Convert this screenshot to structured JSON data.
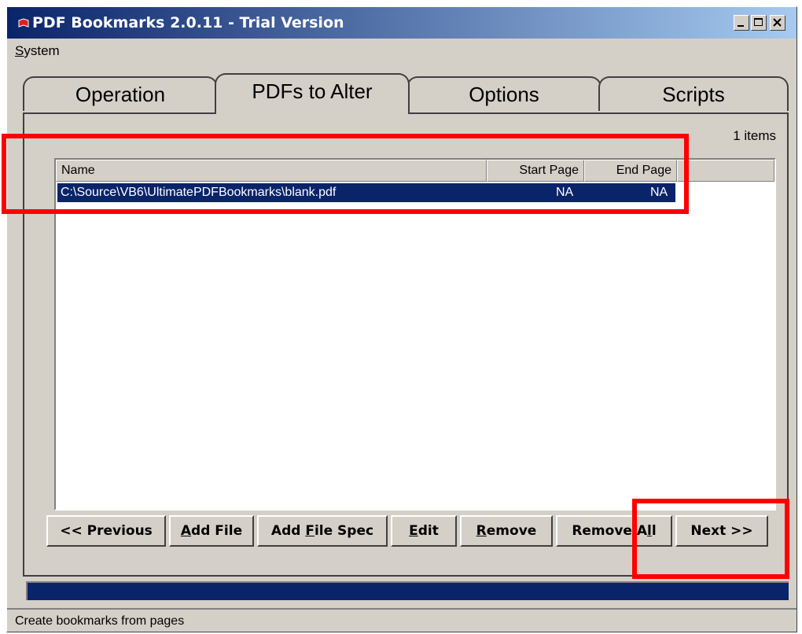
{
  "window": {
    "title": "PDF Bookmarks 2.0.11 - Trial Version"
  },
  "menu": {
    "system_prefix": "",
    "system_accel": "S",
    "system_rest": "ystem"
  },
  "tabs": [
    {
      "label": "Operation"
    },
    {
      "label": "PDFs to Alter"
    },
    {
      "label": "Options"
    },
    {
      "label": "Scripts"
    }
  ],
  "list": {
    "count_text": "1 items",
    "headers": {
      "name": "Name",
      "start": "Start Page",
      "end": "End Page"
    },
    "rows": [
      {
        "name": "C:\\Source\\VB6\\UltimatePDFBookmarks\\blank.pdf",
        "start": "NA",
        "end": "NA"
      }
    ]
  },
  "buttons": {
    "previous": "<< Previous",
    "add_file_accel": "A",
    "add_file_rest": "dd File",
    "add_spec_pre": "Add ",
    "add_spec_accel": "F",
    "add_spec_rest": "ile Spec",
    "edit_accel": "E",
    "edit_rest": "dit",
    "remove_accel": "R",
    "remove_rest": "emove",
    "remove_all_pre": "Remove A",
    "remove_all_accel": "l",
    "remove_all_rest": "l",
    "next": "Next >>"
  },
  "progress": {
    "value_percent": 100,
    "color": "#0a246a"
  },
  "status": {
    "text": "Create bookmarks from pages"
  },
  "colors": {
    "title_bar": "#0a246a",
    "selection": "#0a246a",
    "highlight": "#ff0000",
    "face": "#d4d0c8"
  }
}
